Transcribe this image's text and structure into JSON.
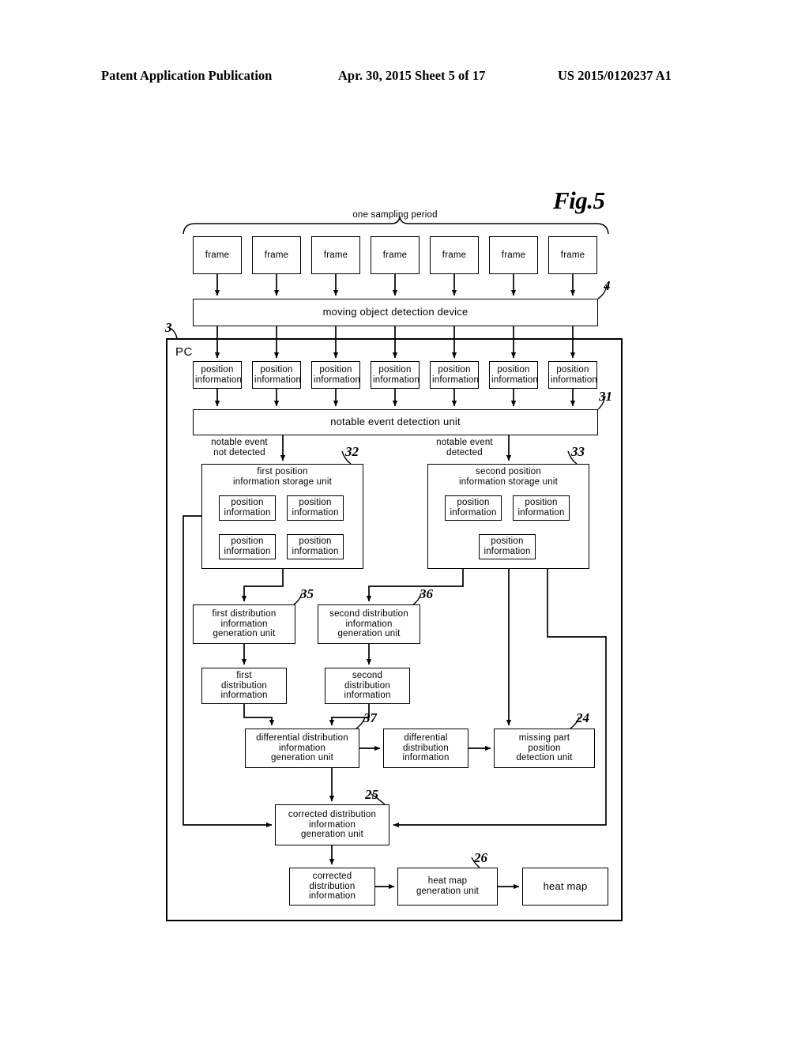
{
  "header": {
    "left": "Patent Application Publication",
    "middle": "Apr. 30, 2015  Sheet 5 of 17",
    "right": "US 2015/0120237 A1"
  },
  "figure": {
    "label": "Fig.5",
    "sampling_period_label": "one  sampling  period",
    "pc_label": "PC"
  },
  "frames": [
    {
      "label": "frame"
    },
    {
      "label": "frame"
    },
    {
      "label": "frame"
    },
    {
      "label": "frame"
    },
    {
      "label": "frame"
    },
    {
      "label": "frame"
    },
    {
      "label": "frame"
    }
  ],
  "detection_device": {
    "label": "moving  object  detection  device",
    "ref": "4"
  },
  "pc": {
    "ref": "3"
  },
  "position_information_row": [
    {
      "label": "position\ninformation"
    },
    {
      "label": "position\ninformation"
    },
    {
      "label": "position\ninformation"
    },
    {
      "label": "position\ninformation"
    },
    {
      "label": "position\ninformation"
    },
    {
      "label": "position\ninformation"
    },
    {
      "label": "position\ninformation"
    }
  ],
  "notable_event_detection_unit": {
    "label": "notable  event  detection  unit",
    "ref": "31"
  },
  "branch_labels": {
    "left": "notable  event\nnot  detected",
    "right": "notable  event\ndetected"
  },
  "first_storage_unit": {
    "title": "first  position\ninformation  storage  unit",
    "ref": "32",
    "items": [
      {
        "label": "position\ninformation"
      },
      {
        "label": "position\ninformation"
      },
      {
        "label": "position\ninformation"
      },
      {
        "label": "position\ninformation"
      }
    ]
  },
  "second_storage_unit": {
    "title": "second  position\ninformation  storage  unit",
    "ref": "33",
    "items": [
      {
        "label": "position\ninformation"
      },
      {
        "label": "position\ninformation"
      },
      {
        "label": "position\ninformation"
      }
    ]
  },
  "first_distribution_generation_unit": {
    "label": "first  distribution\ninformation\ngeneration  unit",
    "ref": "35"
  },
  "second_distribution_generation_unit": {
    "label": "second  distribution\ninformation\ngeneration  unit",
    "ref": "36"
  },
  "first_distribution_information": {
    "label": "first\ndistribution\ninformation"
  },
  "second_distribution_information": {
    "label": "second\ndistribution\ninformation"
  },
  "differential_generation_unit": {
    "label": "differential  distribution\ninformation\ngeneration  unit",
    "ref": "37"
  },
  "differential_information": {
    "label": "differential\ndistribution\ninformation"
  },
  "missing_part_unit": {
    "label": "missing  part\nposition\ndetection  unit",
    "ref": "24"
  },
  "corrected_generation_unit": {
    "label": "corrected  distribution\ninformation\ngeneration  unit",
    "ref": "25"
  },
  "corrected_information": {
    "label": "corrected\ndistribution\ninformation"
  },
  "heat_map_generation_unit": {
    "label": "heat  map\ngeneration  unit",
    "ref": "26"
  },
  "heat_map": {
    "label": "heat  map"
  }
}
